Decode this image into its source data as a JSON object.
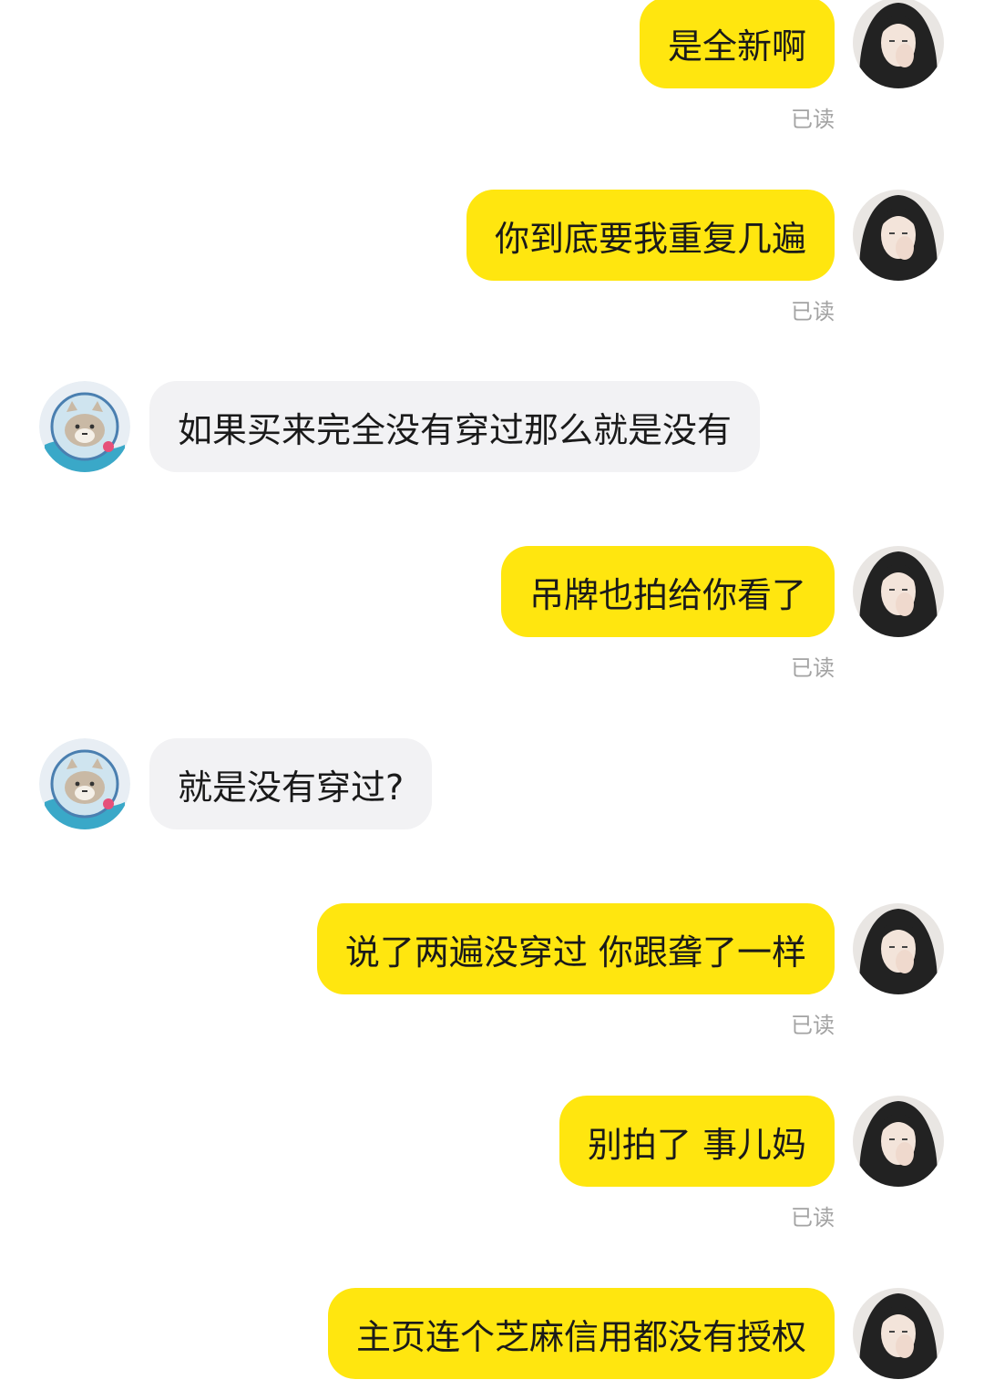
{
  "messages": [
    {
      "side": "me",
      "text": "是全新啊",
      "status": "已读"
    },
    {
      "side": "me",
      "text": "你到底要我重复几遍",
      "status": "已读"
    },
    {
      "side": "them",
      "text": "如果买来完全没有穿过那么就是没有"
    },
    {
      "side": "me",
      "text": "吊牌也拍给你看了",
      "status": "已读"
    },
    {
      "side": "them",
      "text": "就是没有穿过?"
    },
    {
      "side": "me",
      "text": "说了两遍没穿过 你跟聋了一样",
      "status": "已读"
    },
    {
      "side": "me",
      "text": "别拍了 事儿妈",
      "status": "已读"
    },
    {
      "side": "me",
      "text": "主页连个芝麻信用都没有授权"
    }
  ],
  "colors": {
    "sent_bubble": "#FFE60F",
    "received_bubble": "#F2F2F4",
    "read_status": "#A3A3A3"
  },
  "icons": {
    "sent_avatar": "user-photo-avatar",
    "received_avatar": "cat-astronaut-avatar"
  }
}
